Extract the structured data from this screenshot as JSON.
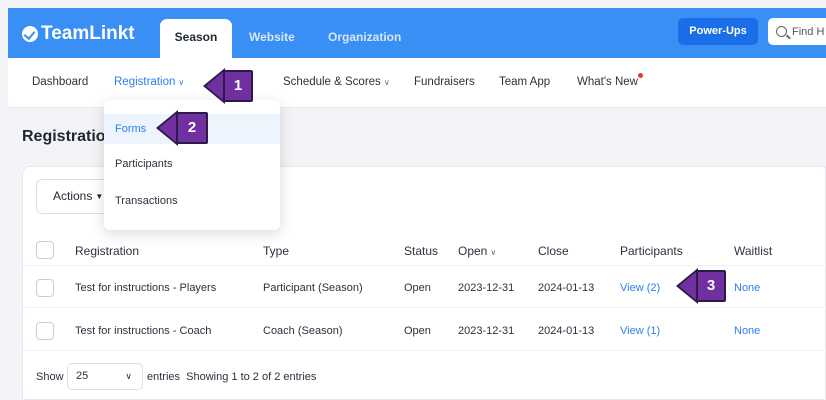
{
  "brand": {
    "name": "TeamLinkt",
    "color": "#3a8ff5"
  },
  "top_tabs": [
    {
      "label": "Season",
      "active": true
    },
    {
      "label": "Website"
    },
    {
      "label": "Organization"
    }
  ],
  "top_right": {
    "powerups": "Power-Ups",
    "search_placeholder": "Find H"
  },
  "subnav": [
    {
      "label": "Dashboard"
    },
    {
      "label": "Registration",
      "dropdown": true,
      "active": true
    },
    {
      "label": "Schedule & Scores",
      "dropdown": true
    },
    {
      "label": "Fundraisers"
    },
    {
      "label": "Team App"
    },
    {
      "label": "What's New",
      "notification": true
    }
  ],
  "dropdown": [
    "Forms",
    "Participants",
    "Transactions"
  ],
  "page_title": "Registration",
  "actions_label": "Actions",
  "table": {
    "headers": [
      "Registration",
      "Type",
      "Status",
      "Open",
      "Close",
      "Participants",
      "Waitlist"
    ],
    "rows": [
      [
        "Test for instructions - Players",
        "Participant (Season)",
        "Open",
        "2023-12-31",
        "2024-01-13",
        "View (2)",
        "None"
      ],
      [
        "Test for instructions - Coach",
        "Coach (Season)",
        "Open",
        "2023-12-31",
        "2024-01-13",
        "View (1)",
        "None"
      ]
    ]
  },
  "footer": {
    "show": "Show",
    "page_size": "25",
    "entries": "entries",
    "info": "Showing 1 to 2 of 2 entries"
  },
  "callouts": [
    "1",
    "2",
    "3"
  ],
  "accent_color": "#2b7ff0",
  "callout_color": "#7030a0"
}
